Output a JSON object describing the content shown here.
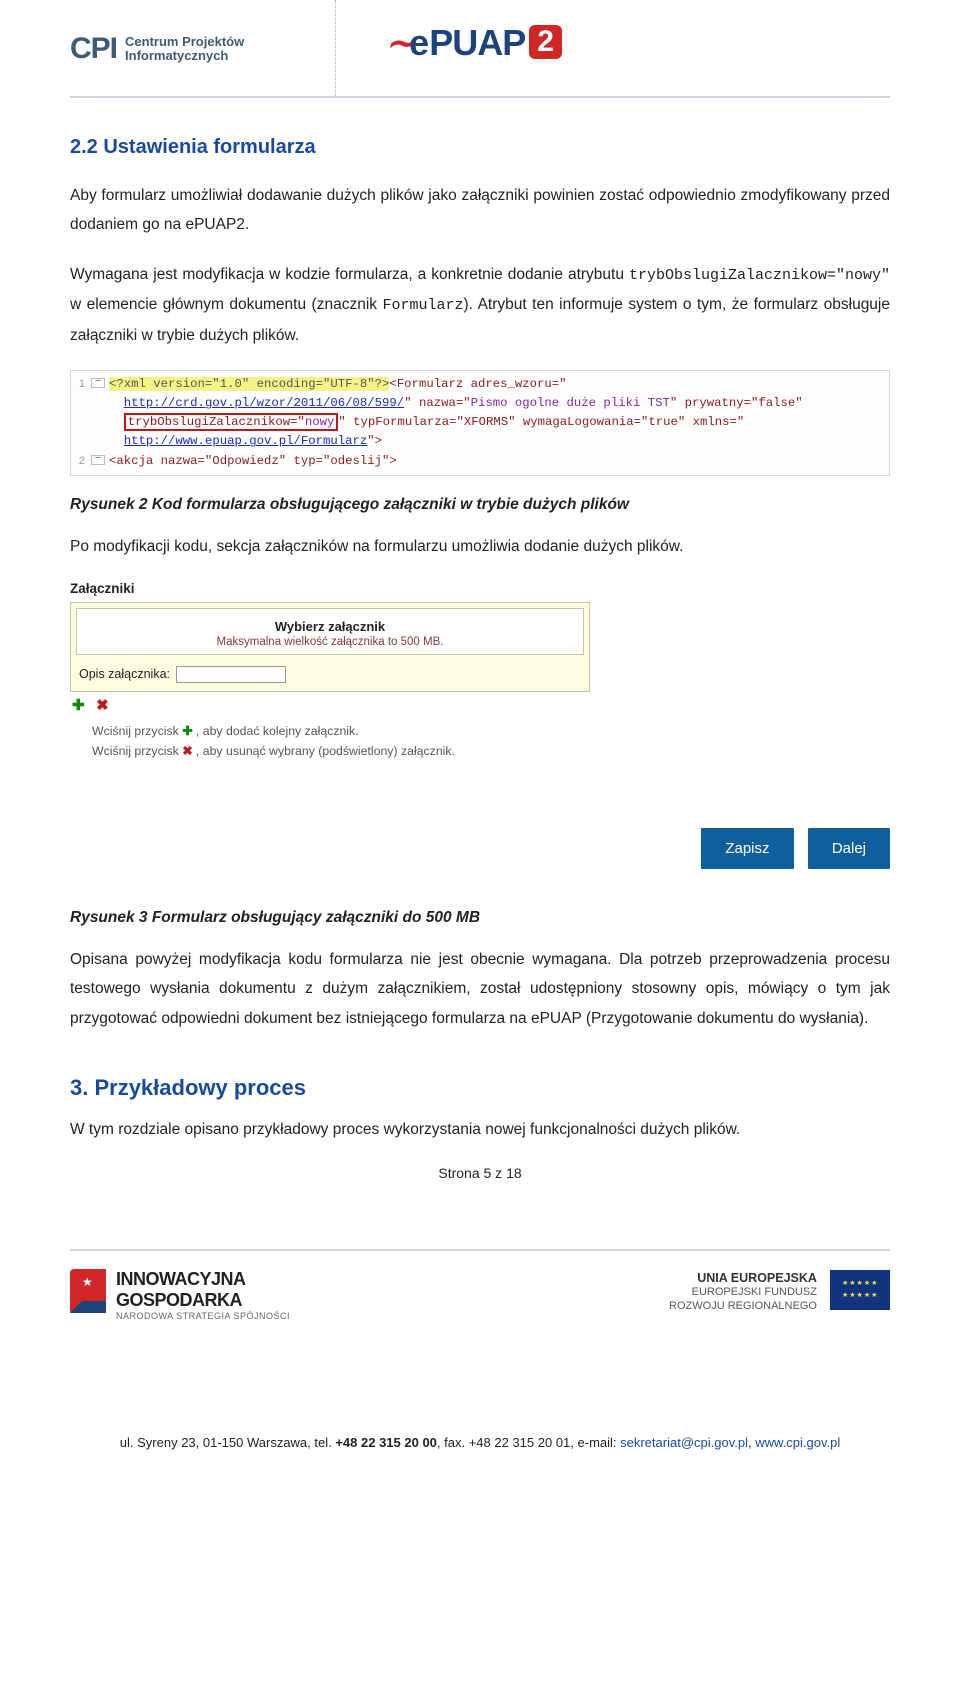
{
  "header": {
    "cpi_name_line1": "Centrum Projektów",
    "cpi_name_line2": "Informatycznych",
    "cpi_mark": "CPI",
    "epuap_prefix": "e",
    "epuap_mid": "PUAP",
    "epuap_suffix": "2"
  },
  "section_title": "2.2  Ustawienia formularza",
  "para1": "Aby formularz umożliwiał dodawanie dużych plików jako załączniki powinien zostać odpowiednio zmodyfikowany przed dodaniem go na ePUAP2.",
  "para2_before_code1": "Wymagana jest modyfikacja w kodzie formularza, a konkretnie dodanie atrybutu ",
  "code1": "trybObslugiZalacznikow=\"nowy\"",
  "para2_mid": " w elemencie głównym dokumentu (znacznik ",
  "code2": "Formularz",
  "para2_after": "). Atrybut ten informuje system o tym, że formularz obsługuje załączniki w trybie dużych plików.",
  "code": {
    "l1_a": "<?xml version=\"1.0\" encoding=\"UTF-8\"?>",
    "l1_b": "<Formularz adres_wzoru=\"",
    "l1_c": "http://crd.gov.pl/wzor/2011/06/08/599/",
    "l1_d": "\" nazwa=\"",
    "l1_e": "Pismo ogolne duże pliki TST",
    "l1_f": "\" prywatny=\"false\"",
    "l1_g": "trybObslugiZalacznikow=\"",
    "l1_h": "nowy",
    "l1_i": "\" typFormularza=\"XFORMS\" wymagaLogowania=\"true\" xmlns=\"",
    "l1_j": "http://www.epuap.gov.pl/Formularz",
    "l1_k": "\">",
    "l2": "<akcja nazwa=\"Odpowiedz\" typ=\"odeslij\">"
  },
  "fig2": "Rysunek 2 Kod formularza obsługującego załączniki w trybie dużych plików",
  "para3": "Po modyfikacji kodu, sekcja załączników na formularzu umożliwia dodanie dużych plików.",
  "attach": {
    "title": "Załączniki",
    "choose": "Wybierz załącznik",
    "max_hint": "Maksymalna wielkość załącznika to 500 MB.",
    "opis_label": "Opis załącznika:",
    "hint_add": "Wciśnij przycisk + , aby dodać kolejny załącznik.",
    "hint_del": "Wciśnij przycisk ✖ , aby usunąć wybrany (podświetlony) załącznik.",
    "btn_save": "Zapisz",
    "btn_next": "Dalej"
  },
  "fig3": "Rysunek 3 Formularz obsługujący załączniki do 500 MB",
  "para4": "Opisana powyżej modyfikacja kodu formularza nie jest obecnie wymagana. Dla potrzeb przeprowadzenia procesu testowego wysłania dokumentu z dużym załącznikiem, został udostępniony stosowny opis, mówiący o tym jak przygotować odpowiedni dokument bez istniejącego formularza na ePUAP (Przygotowanie dokumentu do wysłania).",
  "chapter3": "3. Przykładowy proces",
  "para5": "W tym rozdziale opisano przykładowy proces wykorzystania nowej funkcjonalności dużych plików.",
  "page_num": "Strona 5 z 18",
  "footer": {
    "ig_l1": "INNOWACYJNA",
    "ig_l2": "GOSPODARKA",
    "ig_l3": "NARODOWA STRATEGIA SPÓJNOŚCI",
    "ue_l1": "UNIA EUROPEJSKA",
    "ue_l2": "EUROPEJSKI FUNDUSZ",
    "ue_l3": "ROZWOJU REGIONALNEGO"
  },
  "address": {
    "pre": "ul. Syreny 23, 01-150 Warszawa, tel. ",
    "tel": "+48 22 315 20 00",
    "mid": ", fax. +48 22 315 20 01, e-mail: ",
    "mail": "sekretariat@cpi.gov.pl",
    "sep": ", ",
    "url": "www.cpi.gov.pl"
  }
}
